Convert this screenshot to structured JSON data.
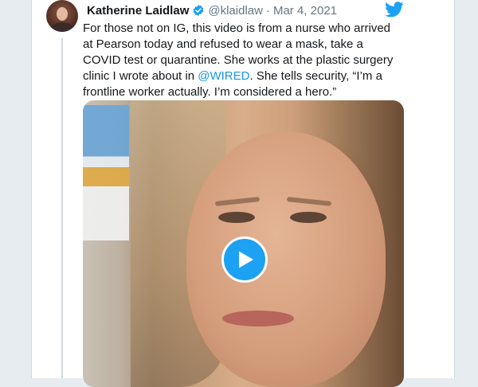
{
  "tweet": {
    "author_name": "Katherine Laidlaw",
    "handle": "@klaidlaw",
    "separator": "·",
    "date": "Mar 4, 2021",
    "text_before_mention": "For those not on IG, this video is from a nurse who arrived at Pearson today and refused to wear a mask, take a COVID test or quarantine. She works at the plastic surgery clinic I wrote about in ",
    "mention": "@WIRED",
    "text_after_mention": ". She tells security, “I’m a frontline worker actually. I’m considered a hero.”"
  },
  "icons": {
    "verified": "verified-badge-icon",
    "brand": "twitter-bird-icon",
    "play": "play-icon"
  },
  "colors": {
    "brand_blue": "#1da1f2",
    "link_blue": "#1b95e0",
    "secondary_text": "#657786",
    "background": "#e6ecf0"
  }
}
